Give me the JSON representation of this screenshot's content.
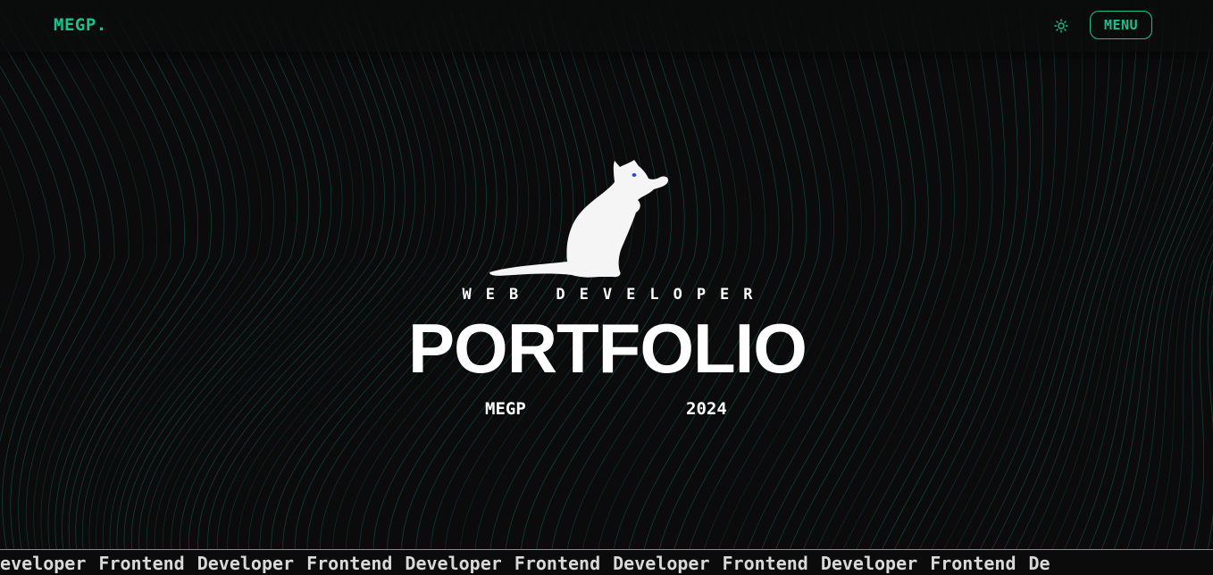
{
  "header": {
    "logo": "MEGP.",
    "theme_toggle_icon": "sun-icon",
    "menu_label": "MENU"
  },
  "hero": {
    "illustration": "cat-icon",
    "eyebrow": "WEB DEVELOPER",
    "title": "PORTFOLIO",
    "name": "MEGP",
    "year": "2024"
  },
  "marquee": {
    "items": [
      "Developer",
      "Frontend",
      "Developer",
      "Frontend",
      "Developer",
      "Frontend",
      "Developer",
      "Frontend",
      "Developer",
      "Frontend",
      "De"
    ]
  },
  "colors": {
    "accent": "#19c28d",
    "background": "#0b0b0b",
    "wave_lines": "#0f5a50",
    "text": "#ffffff"
  }
}
